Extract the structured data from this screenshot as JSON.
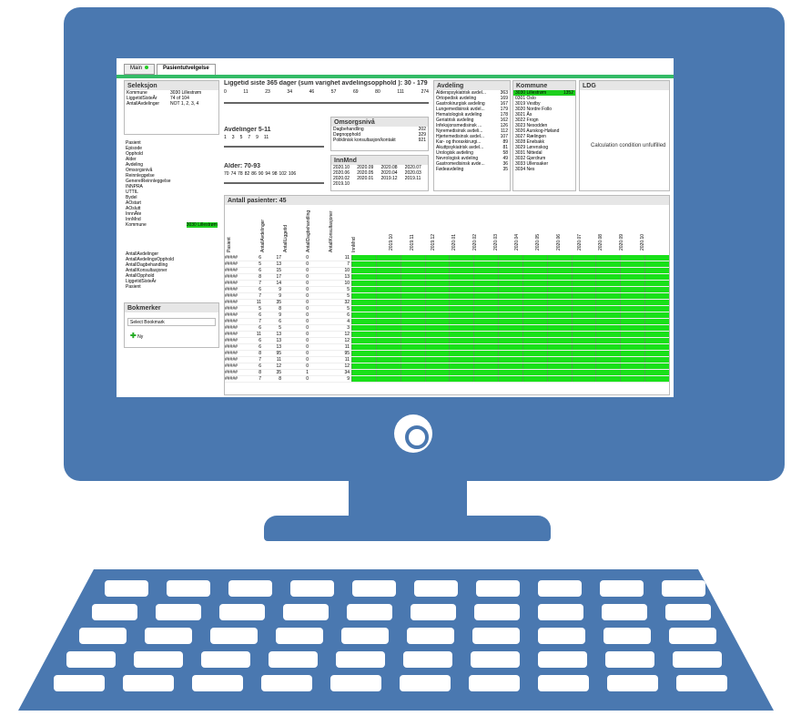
{
  "tabs": [
    "Main",
    "Pasientutvelgelse"
  ],
  "seleksjon": {
    "title": "Seleksjon",
    "rows": [
      [
        "Kommune",
        "3030 Lillestrøm"
      ],
      [
        "LiggetidSisteÅr",
        "74 of 104"
      ],
      [
        "AntallAvdelinger",
        "NOT 1, 2, 3, 4"
      ]
    ]
  },
  "fields": [
    "Pasient",
    "Episode",
    "Opphold",
    "Alder",
    "Avdeling",
    "Omsorgsnivå",
    "Reinnleggelse",
    "GenerelReinnleggelse",
    "INNPRA",
    "UTTIL",
    "Bydel",
    "AOstart",
    "AOslutt",
    "InnnÅte",
    "InnMnd",
    "Kommune"
  ],
  "kommune_selected": "3030 Lillestrøm",
  "fields2": [
    "AntallAvdelinger",
    "AntallAvdelingsOpphold",
    "AntallDagbehandling",
    "AntallKonsultasjoner",
    "AntallOpphold",
    "LiggetidSisteÅr",
    "Pasient"
  ],
  "bokmerker": {
    "title": "Bokmerker",
    "select": "Select Bookmark",
    "new": "Ny"
  },
  "liggetid": {
    "title": "Liggetid siste 365 dager (sum varighet avdelingsopphold ): 30 - 179",
    "ticks": [
      "0",
      "11",
      "23",
      "34",
      "46",
      "57",
      "69",
      "80",
      "111",
      "274"
    ]
  },
  "avdelinger": {
    "title": "Avdelinger  5-11",
    "ticks": [
      "1",
      "3",
      "5",
      "7",
      "9",
      "11"
    ]
  },
  "alder": {
    "title": "Alder: 70-93",
    "ticks": [
      "70",
      "74",
      "78",
      "82",
      "86",
      "90",
      "94",
      "98",
      "102",
      "106"
    ]
  },
  "omsorg": {
    "title": "Omsorgsnivå",
    "rows": [
      [
        "Dagbehandling",
        "202"
      ],
      [
        "Døgnopphold",
        "329"
      ],
      [
        "Poliklinisk konsultasjon/kontakt",
        "921"
      ]
    ]
  },
  "innmnd": {
    "title": "InnMnd",
    "rows": [
      [
        "2020.10",
        "2020.09",
        "2020.08",
        "2020.07"
      ],
      [
        "2020.06",
        "2020.05",
        "2020.04",
        "2020.03"
      ],
      [
        "2020.02",
        "2020.01",
        "2019.12",
        "2019.11"
      ],
      [
        "2019.10",
        "",
        "",
        ""
      ]
    ]
  },
  "avdeling": {
    "title": "Avdeling",
    "rows": [
      [
        "Alderspsykiatrisk avdel...",
        "363"
      ],
      [
        "Ortopedisk avdeling",
        "169"
      ],
      [
        "Gastrokirurgisk avdeling",
        "167"
      ],
      [
        "Lungemedisinsk avdel...",
        "179"
      ],
      [
        "Hematologisk avdeling",
        "178"
      ],
      [
        "Geriatrisk avdeling",
        "162"
      ],
      [
        "Infeksjonsmedisinsk ...",
        "126"
      ],
      [
        "Nyremedisinsk avdeli...",
        "112"
      ],
      [
        "Hjertemedisinsk avdel...",
        "107"
      ],
      [
        "Kar- og thoraxkirurgi...",
        "89"
      ],
      [
        "Akuttpsykiatrisk avdel...",
        "81"
      ],
      [
        "Urologisk avdeling",
        "58"
      ],
      [
        "Nevrologisk avdeling",
        "49"
      ],
      [
        "Gastromedisinsk avde...",
        "36"
      ],
      [
        "Fødeavdeling",
        "35"
      ]
    ]
  },
  "kommune": {
    "title": "Kommune",
    "rows": [
      "3030 Lillestrøm",
      "0301 Oslo",
      "3019 Vestby",
      "3020 Nordre Follo",
      "3021 Ås",
      "3022 Frogn",
      "3023 Nesodden",
      "3026 Aurskog-Høland",
      "3027 Rælingen",
      "3028 Enebakk",
      "3029 Lørenskog",
      "3031 Nittedal",
      "3032 Gjerdrum",
      "3033 Ullensaker",
      "3034 Nes"
    ],
    "count": "1352"
  },
  "ldg": {
    "title": "LDG",
    "msg": "Calculation condition unfulfilled"
  },
  "table": {
    "title": "Antall pasienter: 45",
    "cols": [
      "Pasient",
      "AntallAvdelinger",
      "AntallLiggetid",
      "AntallDagbehandling",
      "AntallKonsultasjoner",
      "InnMnd"
    ],
    "months": [
      "2019.10",
      "2019.11",
      "2019.12",
      "2020.01",
      "2020.02",
      "2020.03",
      "2020.04",
      "2020.05",
      "2020.06",
      "2020.07",
      "2020.08",
      "2020.09",
      "2020.10"
    ],
    "rows": [
      [
        "#####",
        "6",
        "17",
        "0",
        "11"
      ],
      [
        "#####",
        "5",
        "13",
        "0",
        "7"
      ],
      [
        "#####",
        "6",
        "15",
        "0",
        "10"
      ],
      [
        "#####",
        "8",
        "17",
        "0",
        "13"
      ],
      [
        "#####",
        "7",
        "14",
        "0",
        "10"
      ],
      [
        "#####",
        "6",
        "9",
        "0",
        "5"
      ],
      [
        "#####",
        "7",
        "9",
        "0",
        "5"
      ],
      [
        "#####",
        "11",
        "35",
        "0",
        "32"
      ],
      [
        "#####",
        "5",
        "8",
        "0",
        "5"
      ],
      [
        "#####",
        "6",
        "9",
        "0",
        "6"
      ],
      [
        "#####",
        "7",
        "6",
        "0",
        "4"
      ],
      [
        "#####",
        "6",
        "5",
        "0",
        "3"
      ],
      [
        "#####",
        "11",
        "13",
        "0",
        "12"
      ],
      [
        "#####",
        "6",
        "13",
        "0",
        "12"
      ],
      [
        "#####",
        "6",
        "13",
        "0",
        "11"
      ],
      [
        "#####",
        "8",
        "95",
        "0",
        "95"
      ],
      [
        "#####",
        "7",
        "11",
        "0",
        "11"
      ],
      [
        "#####",
        "6",
        "12",
        "0",
        "12"
      ],
      [
        "#####",
        "8",
        "35",
        "1",
        "34"
      ],
      [
        "#####",
        "7",
        "8",
        "0",
        "9"
      ]
    ]
  }
}
